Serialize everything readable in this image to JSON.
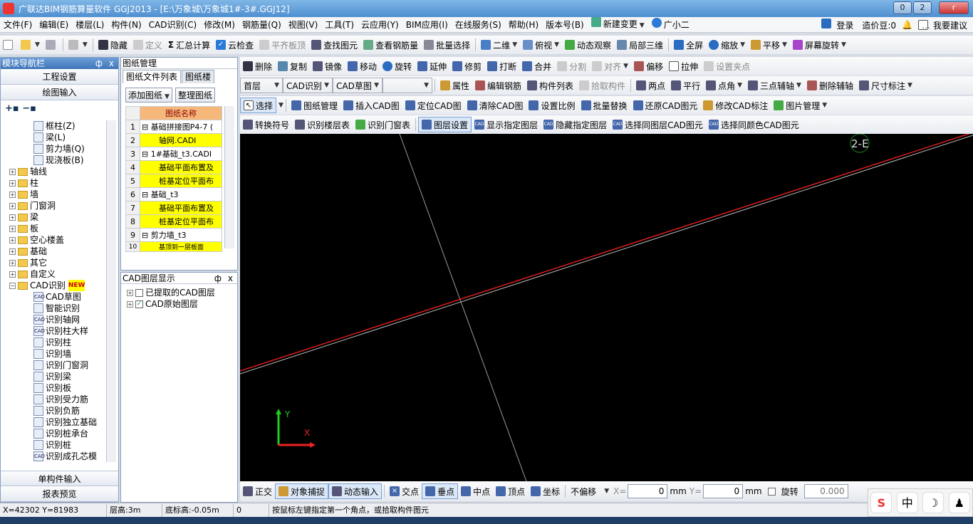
{
  "window": {
    "title": "广联达BIM钢筋算量软件 GGJ2013 - [E:\\万象城\\万象城1#-3#.GGJ12]",
    "min": "0",
    "restore": "2",
    "close": "r"
  },
  "menu": [
    "文件(F)",
    "编辑(E)",
    "楼层(L)",
    "构件(N)",
    "CAD识别(C)",
    "修改(M)",
    "钢筋量(Q)",
    "视图(V)",
    "工具(T)",
    "云应用(Y)",
    "BIM应用(I)",
    "在线服务(S)",
    "帮助(H)",
    "版本号(B)",
    "新建变更",
    "广小二"
  ],
  "menu_right": [
    "登录",
    "造价豆:0",
    "我要建议"
  ],
  "toolbar1": [
    "隐藏",
    "定义",
    "汇总计算",
    "云检查",
    "平齐板顶",
    "查找图元",
    "查看钢筋量",
    "批量选择",
    "二维",
    "俯视",
    "动态观察",
    "局部三维",
    "全屏",
    "缩放",
    "平移",
    "屏幕旋转"
  ],
  "toolbar2": [
    "删除",
    "复制",
    "镜像",
    "移动",
    "旋转",
    "延伸",
    "修剪",
    "打断",
    "合并",
    "分割",
    "对齐",
    "偏移",
    "拉伸",
    "设置夹点"
  ],
  "toolbar3": {
    "floor": "首层",
    "cad": "CAD识别",
    "draft": "CAD草图",
    "items": [
      "属性",
      "编辑钢筋",
      "构件列表",
      "拾取构件",
      "两点",
      "平行",
      "点角",
      "三点辅轴",
      "删除辅轴",
      "尺寸标注"
    ]
  },
  "toolbar4": [
    "选择",
    "图纸管理",
    "插入CAD图",
    "定位CAD图",
    "清除CAD图",
    "设置比例",
    "批量替换",
    "还原CAD图元",
    "修改CAD标注",
    "图片管理"
  ],
  "toolbar5": [
    "转换符号",
    "识别楼层表",
    "识别门窗表",
    "图层设置",
    "显示指定图层",
    "隐藏指定图层",
    "选择同图层CAD图元",
    "选择同颜色CAD图元"
  ],
  "nav": {
    "title": "模块导航栏",
    "pin": "ф",
    "close": "x",
    "top_buttons": [
      "工程设置",
      "绘图输入"
    ],
    "tree_top": [
      "框柱(Z)",
      "梁(L)",
      "剪力墙(Q)",
      "现浇板(B)"
    ],
    "folders": [
      "轴线",
      "柱",
      "墙",
      "门窗洞",
      "梁",
      "板",
      "空心楼盖",
      "基础",
      "其它",
      "自定义"
    ],
    "cad_folder": "CAD识别",
    "new_badge": "NEW",
    "cad_items": [
      "CAD草图",
      "智能识别",
      "识别轴网",
      "识别柱大样",
      "识别柱",
      "识别墙",
      "识别门窗洞",
      "识别梁",
      "识别板",
      "识别受力筋",
      "识别负筋",
      "识别独立基础",
      "识别桩承台",
      "识别桩",
      "识别成孔芯模"
    ],
    "bottom_buttons": [
      "单构件输入",
      "报表预览"
    ]
  },
  "drawing": {
    "title": "图纸管理",
    "tabs": [
      "图纸文件列表",
      "图纸楼"
    ],
    "buttons": [
      "添加图纸",
      "整理图纸"
    ],
    "header": "图纸名称",
    "rows": [
      {
        "n": "1",
        "name": "基础拼接图P4-7 (",
        "group": true
      },
      {
        "n": "2",
        "name": "轴网.CADI",
        "group": false
      },
      {
        "n": "3",
        "name": "1#基础_t3.CADI",
        "group": true
      },
      {
        "n": "4",
        "name": "基础平面布置及",
        "group": false
      },
      {
        "n": "5",
        "name": "桩基定位平面布",
        "group": false
      },
      {
        "n": "6",
        "name": "基础_t3",
        "group": true
      },
      {
        "n": "7",
        "name": "基础平面布置及",
        "group": false
      },
      {
        "n": "8",
        "name": "桩基定位平面布",
        "group": false
      },
      {
        "n": "9",
        "name": "剪力墙_t3",
        "group": true
      },
      {
        "n": "10",
        "name": "基顶到一层板面",
        "group": false
      }
    ]
  },
  "layers": {
    "title": "CAD图层显示",
    "items": [
      {
        "label": "已提取的CAD图层",
        "checked": false
      },
      {
        "label": "CAD原始图层",
        "checked": true
      }
    ]
  },
  "canvas": {
    "axis_label": "2-E",
    "y_label": "Y",
    "x_label": "X"
  },
  "bottom": {
    "items": [
      "正交",
      "对象捕捉",
      "动态输入",
      "交点",
      "垂点",
      "中点",
      "顶点",
      "坐标"
    ],
    "offset": "不偏移",
    "x_label": "X=",
    "x_val": "0",
    "y_label": "Y=",
    "y_val": "0",
    "unit": "mm",
    "rotate_label": "旋转",
    "rotate_val": "0.000"
  },
  "status": {
    "coords": "X=42302 Y=81983",
    "floor_h": "层高:3m",
    "base_h": "底标高:-0.05m",
    "zero": "0",
    "hint": "按鼠标左键指定第一个角点，或拾取构件图元"
  },
  "ime": [
    "S",
    "中",
    "☽",
    "♟"
  ]
}
